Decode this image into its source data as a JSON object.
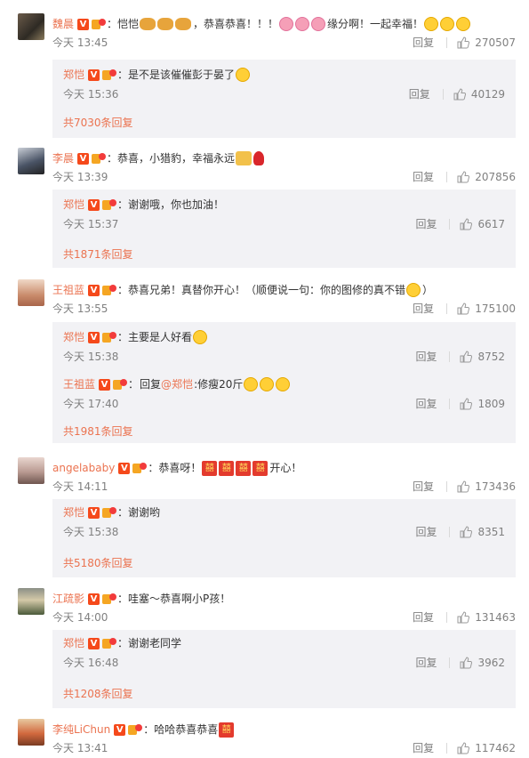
{
  "ui": {
    "reply_label": "回复",
    "vip_letter": "V",
    "xi_glyph": "囍",
    "reply_prefix": "回复"
  },
  "comments": [
    {
      "user": "魏晨",
      "text_parts": [
        "：恺恺",
        "，恭喜恭喜！！！",
        "缘分啊！一起幸福！"
      ],
      "time": "今天 13:45",
      "likes": "270507",
      "replies": [
        {
          "user": "郑恺",
          "text": "：是不是该催催彭于晏了",
          "time": "今天 15:36",
          "likes": "40129"
        }
      ],
      "more": "共7030条回复"
    },
    {
      "user": "李晨",
      "text_parts": [
        "：恭喜，小猎豹，幸福永远"
      ],
      "time": "今天 13:39",
      "likes": "207856",
      "replies": [
        {
          "user": "郑恺",
          "text": "：谢谢哦，你也加油！",
          "time": "今天 15:37",
          "likes": "6617"
        }
      ],
      "more": "共1871条回复"
    },
    {
      "user": "王祖蓝",
      "text_parts": [
        "：恭喜兄弟！真替你开心！（顺便说一句：你的图修的真不错",
        "）"
      ],
      "time": "今天 13:55",
      "likes": "175100",
      "replies": [
        {
          "user": "郑恺",
          "text": "：主要是人好看",
          "time": "今天 15:38",
          "likes": "8752"
        },
        {
          "user": "王祖蓝",
          "text": "：",
          "mention": "@郑恺",
          "after": ":修瘦20斤",
          "time": "今天 17:40",
          "likes": "1809"
        }
      ],
      "more": "共1981条回复"
    },
    {
      "user": "angelababy",
      "text_parts": [
        "：恭喜呀！",
        "开心！"
      ],
      "time": "今天 14:11",
      "likes": "173436",
      "replies": [
        {
          "user": "郑恺",
          "text": "：谢谢哟",
          "time": "今天 15:38",
          "likes": "8351"
        }
      ],
      "more": "共5180条回复"
    },
    {
      "user": "江疏影",
      "text_parts": [
        "：哇塞～恭喜啊小P孩！"
      ],
      "time": "今天 14:00",
      "likes": "131463",
      "replies": [
        {
          "user": "郑恺",
          "text": "：谢谢老同学",
          "time": "今天 16:48",
          "likes": "3962"
        }
      ],
      "more": "共1208条回复"
    },
    {
      "user": "李纯LiChun",
      "text_parts": [
        "：哈哈恭喜恭喜"
      ],
      "time": "今天 13:41",
      "likes": "117462"
    }
  ],
  "colors": {
    "name": "#eb7350",
    "meta": "#808080",
    "reply_bg": "#f2f2f5",
    "vip": "#f5491b"
  }
}
